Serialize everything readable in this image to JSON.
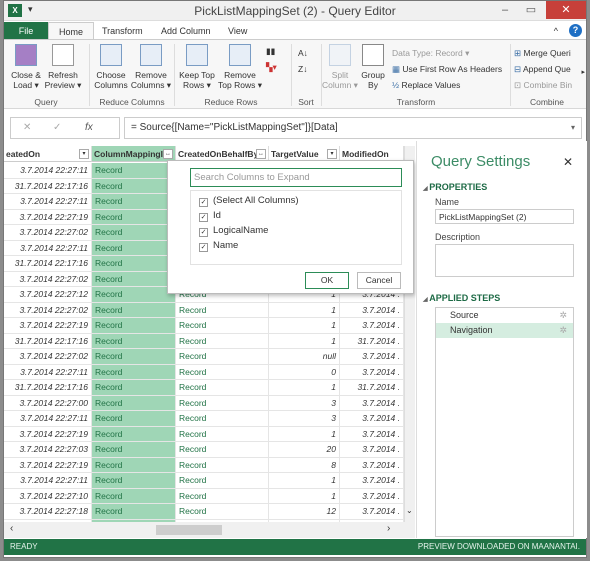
{
  "window": {
    "title": "PickListMappingSet (2) - Query Editor",
    "app_icon": "X"
  },
  "tabs": [
    {
      "label": "File"
    },
    {
      "label": "Home"
    },
    {
      "label": "Transform"
    },
    {
      "label": "Add Column"
    },
    {
      "label": "View"
    }
  ],
  "ribbon": {
    "close_load": "Close &\nLoad ▾",
    "refresh": "Refresh\nPreview ▾",
    "group_query": "Query",
    "choose_cols": "Choose\nColumns",
    "remove_cols": "Remove\nColumns ▾",
    "group_reduce_cols": "Reduce Columns",
    "keep_top": "Keep Top\nRows ▾",
    "remove_top": "Remove\nTop Rows ▾",
    "group_reduce_rows": "Reduce Rows",
    "group_sort": "Sort",
    "split": "Split\nColumn ▾",
    "group_by": "Group\nBy",
    "data_type": "Data Type: Record ▾",
    "first_row": "Use First Row As Headers",
    "replace": "Replace Values",
    "group_transform": "Transform",
    "merge": "Merge Queri",
    "append": "Append Que",
    "combine_bin": "Combine Bin",
    "group_combine": "Combine"
  },
  "formula": {
    "value": "= Source{[Name=\"PickListMappingSet\"]}[Data]",
    "fx": "fx"
  },
  "columns": [
    "eatedOn",
    "ColumnMappingId",
    "CreatedOnBehalfBy",
    "TargetValue",
    "ModifiedOn"
  ],
  "rows": [
    [
      "3.7.2014 22:27:11",
      "Record",
      "",
      "",
      ""
    ],
    [
      "31.7.2014 22:17:16",
      "Record",
      "",
      "",
      ""
    ],
    [
      "3.7.2014 22:27:11",
      "Record",
      "",
      "",
      ""
    ],
    [
      "3.7.2014 22:27:19",
      "Record",
      "",
      "",
      ""
    ],
    [
      "3.7.2014 22:27:02",
      "Record",
      "",
      "",
      ""
    ],
    [
      "3.7.2014 22:27:11",
      "Record",
      "",
      "",
      ""
    ],
    [
      "31.7.2014 22:17:16",
      "Record",
      "",
      "",
      ""
    ],
    [
      "3.7.2014 22:27:02",
      "Record",
      "",
      "",
      ""
    ],
    [
      "3.7.2014 22:27:12",
      "Record",
      "Record",
      "1",
      "3.7.2014 ."
    ],
    [
      "3.7.2014 22:27:02",
      "Record",
      "Record",
      "1",
      "3.7.2014 ."
    ],
    [
      "3.7.2014 22:27:19",
      "Record",
      "Record",
      "1",
      "3.7.2014 ."
    ],
    [
      "31.7.2014 22:17:16",
      "Record",
      "Record",
      "1",
      "31.7.2014 ."
    ],
    [
      "3.7.2014 22:27:02",
      "Record",
      "Record",
      "null",
      "3.7.2014 ."
    ],
    [
      "3.7.2014 22:27:11",
      "Record",
      "Record",
      "0",
      "3.7.2014 ."
    ],
    [
      "31.7.2014 22:17:16",
      "Record",
      "Record",
      "1",
      "31.7.2014 ."
    ],
    [
      "3.7.2014 22:27:00",
      "Record",
      "Record",
      "3",
      "3.7.2014 ."
    ],
    [
      "3.7.2014 22:27:11",
      "Record",
      "Record",
      "3",
      "3.7.2014 ."
    ],
    [
      "3.7.2014 22:27:19",
      "Record",
      "Record",
      "1",
      "3.7.2014 ."
    ],
    [
      "3.7.2014 22:27:03",
      "Record",
      "Record",
      "20",
      "3.7.2014 ."
    ],
    [
      "3.7.2014 22:27:19",
      "Record",
      "Record",
      "8",
      "3.7.2014 ."
    ],
    [
      "3.7.2014 22:27:11",
      "Record",
      "Record",
      "1",
      "3.7.2014 ."
    ],
    [
      "3.7.2014 22:27:10",
      "Record",
      "Record",
      "1",
      "3.7.2014 ."
    ],
    [
      "3.7.2014 22:27:18",
      "Record",
      "Record",
      "12",
      "3.7.2014 ."
    ],
    [
      "3.7.2014 22:27:03",
      "Record",
      "Record",
      "7",
      "3.7.2014 ."
    ]
  ],
  "expand_popup": {
    "search_placeholder": "Search Columns to Expand",
    "options": [
      {
        "label": "(Select All Columns)",
        "checked": true
      },
      {
        "label": "Id",
        "checked": true
      },
      {
        "label": "LogicalName",
        "checked": true
      },
      {
        "label": "Name",
        "checked": true
      }
    ],
    "ok": "OK",
    "cancel": "Cancel"
  },
  "query_settings": {
    "title": "Query Settings",
    "properties": "PROPERTIES",
    "name_label": "Name",
    "name_value": "PickListMappingSet (2)",
    "description_label": "Description",
    "applied_steps": "APPLIED STEPS",
    "steps": [
      {
        "label": "Source"
      },
      {
        "label": "Navigation",
        "selected": true
      }
    ]
  },
  "status": {
    "left": "READY",
    "right": "PREVIEW DOWNLOADED ON MAANANTAI."
  },
  "colors": {
    "accent": "#217346",
    "selected_column": "#9fd6b6"
  }
}
